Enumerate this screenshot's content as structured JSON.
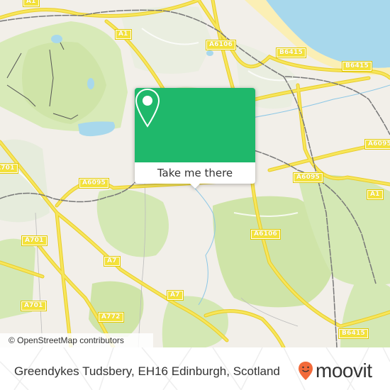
{
  "map": {
    "attribution": "© OpenStreetMap contributors",
    "road_labels": [
      {
        "id": "a1-top-left",
        "text": "A1"
      },
      {
        "id": "a1-top",
        "text": "A1"
      },
      {
        "id": "a6106-top",
        "text": "A6106"
      },
      {
        "id": "b6415-top",
        "text": "B6415"
      },
      {
        "id": "b6415-right",
        "text": "B6415"
      },
      {
        "id": "a6095-right",
        "text": "A6095"
      },
      {
        "id": "a701-left-top",
        "text": "A701"
      },
      {
        "id": "a6095-left",
        "text": "A6095"
      },
      {
        "id": "a6095-center",
        "text": "A6095"
      },
      {
        "id": "a1-right",
        "text": "A1"
      },
      {
        "id": "a6106-center",
        "text": "A6106"
      },
      {
        "id": "a701-mid",
        "text": "A701"
      },
      {
        "id": "a7-left",
        "text": "A7"
      },
      {
        "id": "a7-mid",
        "text": "A7"
      },
      {
        "id": "a701-bottom",
        "text": "A701"
      },
      {
        "id": "a772",
        "text": "A772"
      },
      {
        "id": "b6415-bottom",
        "text": "B6415"
      }
    ],
    "colors": {
      "land": "#f2efe9",
      "park": "#d4e8b4",
      "water": "#a8d8ec",
      "sand": "#fbefb5",
      "road": "#f4e23a",
      "rail": "#777777"
    }
  },
  "popup": {
    "icon": "map-pin-icon",
    "button_label": "Take me there",
    "color": "#1fb86b"
  },
  "footer": {
    "address": "Greendykes Tudsbery, EH16 Edinburgh, Scotland",
    "logo_text": "moovit",
    "logo_icon": "moovit-pin-icon",
    "logo_color": "#f26a3a"
  }
}
